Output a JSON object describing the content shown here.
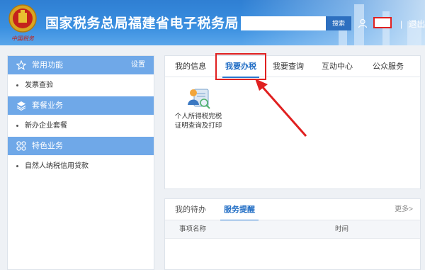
{
  "header": {
    "title": "国家税务总局福建省电子税务局",
    "search_placeholder": "",
    "search_button": "搜索",
    "logout_label": "退出",
    "logout_separator": "|"
  },
  "sidebar": {
    "sections": [
      {
        "title": "常用功能",
        "icon": "star-icon",
        "action": "设置",
        "items": [
          "发票查验"
        ]
      },
      {
        "title": "套餐业务",
        "icon": "layers-icon",
        "items": [
          "新办企业套餐"
        ]
      },
      {
        "title": "特色业务",
        "icon": "grid-icon",
        "items": [
          "自然人纳税信用贷款"
        ]
      }
    ]
  },
  "main": {
    "tabs": [
      "我的信息",
      "我要办税",
      "我要查询",
      "互动中心",
      "公众服务"
    ],
    "active_tab": "我要办税",
    "service": {
      "label_line1": "个人所得税完税",
      "label_line2": "证明查询及打印",
      "icon": "tax-certificate-icon"
    }
  },
  "bottom": {
    "tabs": [
      "我的待办",
      "服务提醒"
    ],
    "active_tab": "服务提醒",
    "more": "更多>",
    "columns": [
      "事项名称",
      "时间"
    ]
  },
  "colors": {
    "header_blue": "#3a8fe0",
    "sidebar_head": "#6fa8e8",
    "active_tab": "#1f6cc4",
    "highlight_red": "#e02020"
  }
}
